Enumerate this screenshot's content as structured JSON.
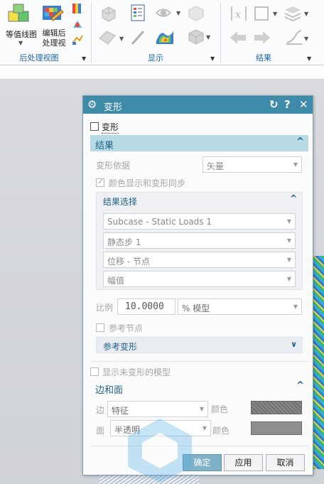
{
  "ribbon": {
    "groups": [
      {
        "label": "后处理视图",
        "buttons": [
          {
            "label": "等值线图"
          },
          {
            "label": "编辑后\n处理视"
          }
        ]
      },
      {
        "label": "显示"
      },
      {
        "label": "结果"
      }
    ]
  },
  "dialog": {
    "title": "变形",
    "deform_checkbox": {
      "label": "变形",
      "checked": false
    },
    "results_section": {
      "title": "结果",
      "deform_basis": {
        "label": "变形依据",
        "value": "矢量"
      },
      "sync_checkbox": {
        "label": "颜色显示和变形同步",
        "checked": true
      },
      "result_selection": {
        "title": "结果选择",
        "dropdowns": [
          "Subcase - Static Loads 1",
          "静态步 1",
          "位移 - 节点",
          "幅值"
        ]
      },
      "scale": {
        "label": "比例",
        "value": "10.0000",
        "mode": "% 模型"
      },
      "reference_node": {
        "label": "参考节点",
        "checked": false
      },
      "reference_deform": {
        "title": "参考变形"
      }
    },
    "show_undeformed": {
      "label": "显示未变形的模型",
      "checked": false
    },
    "edges_faces_section": {
      "title": "边和面",
      "edge": {
        "label": "边",
        "value": "特征",
        "color_label": "颜色"
      },
      "face": {
        "label": "面",
        "value": "半透明",
        "color_label": "颜色"
      }
    },
    "buttons": {
      "ok": "确定",
      "apply": "应用",
      "cancel": "取消"
    }
  },
  "colors": {
    "titlebar": "#3e8ba9",
    "section_header": "#b6dbe6",
    "primary_button": "#7db2c9"
  }
}
